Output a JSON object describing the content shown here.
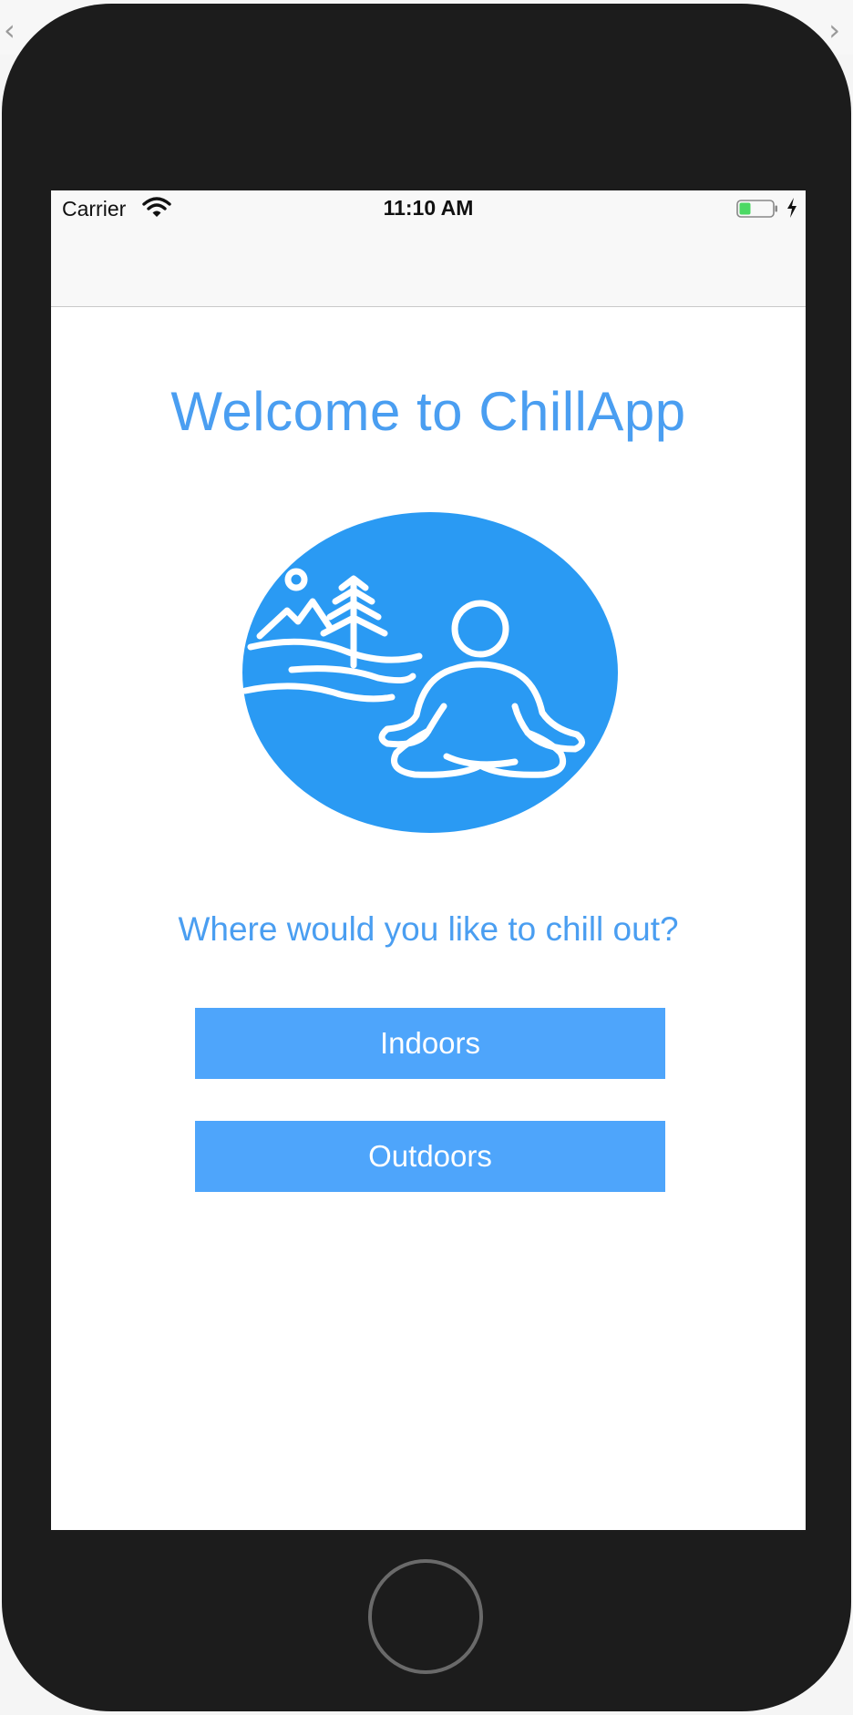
{
  "status_bar": {
    "carrier": "Carrier",
    "time": "11:10 AM",
    "wifi_icon": "wifi-icon",
    "battery_icon": "battery-charging-icon"
  },
  "main": {
    "title": "Welcome to ChillApp",
    "logo_icon": "meditation-nature-logo",
    "question": "Where would you like to chill out?",
    "buttons": [
      {
        "label": "Indoors"
      },
      {
        "label": "Outdoors"
      }
    ]
  },
  "device": {
    "home_button_icon": "home-button"
  },
  "colors": {
    "accent": "#4a9ef1",
    "button": "#4ea5fb",
    "logo": "#2a9af3",
    "device": "#1c1c1c"
  }
}
